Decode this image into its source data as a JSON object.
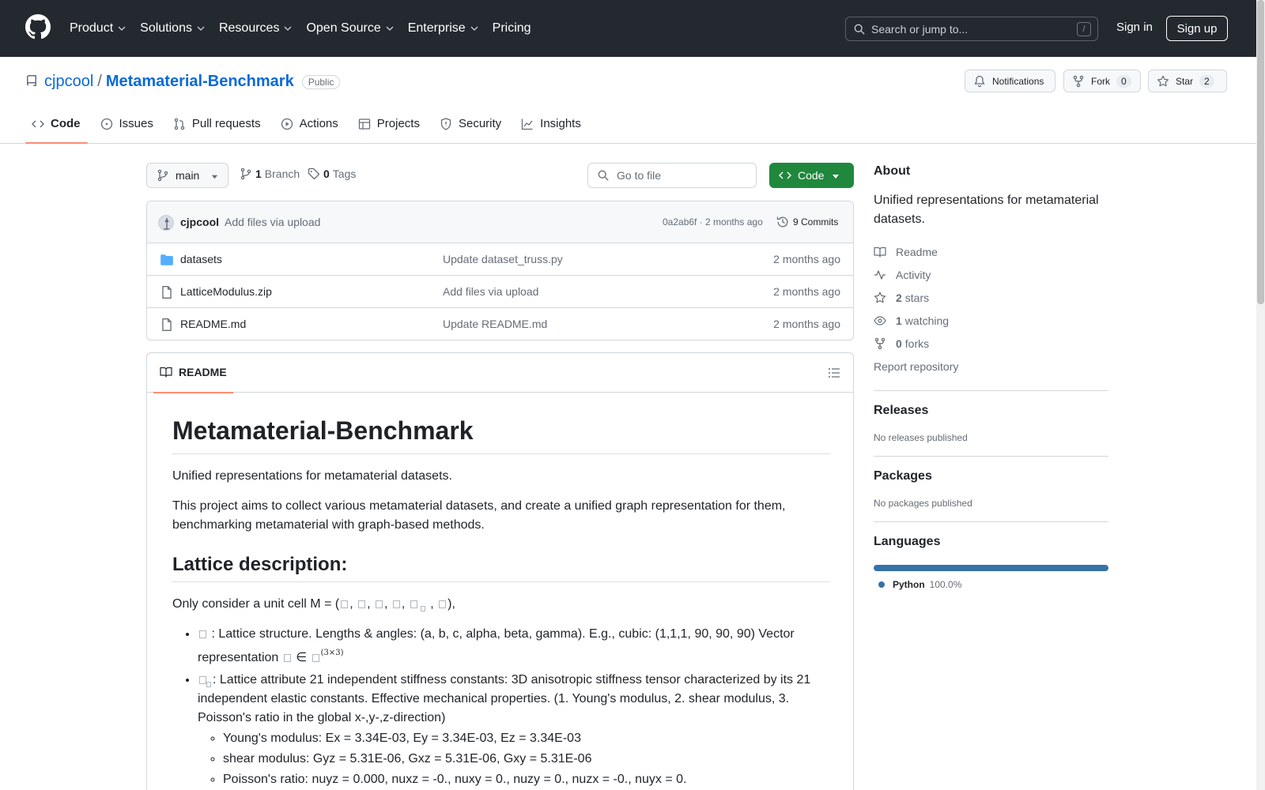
{
  "nav": {
    "items": [
      "Product",
      "Solutions",
      "Resources",
      "Open Source",
      "Enterprise",
      "Pricing"
    ],
    "search_placeholder": "Search or jump to...",
    "search_key": "/",
    "signin": "Sign in",
    "signup": "Sign up"
  },
  "repo": {
    "owner": "cjpcool",
    "separator": "/",
    "name": "Metamaterial-Benchmark",
    "visibility": "Public",
    "notifications": "Notifications",
    "fork_label": "Fork",
    "fork_count": "0",
    "star_label": "Star",
    "star_count": "2"
  },
  "tabs": [
    "Code",
    "Issues",
    "Pull requests",
    "Actions",
    "Projects",
    "Security",
    "Insights"
  ],
  "toolbar": {
    "branch": "main",
    "branch_count": "1",
    "branch_label": "Branch",
    "tag_count": "0",
    "tag_label": "Tags",
    "goto_placeholder": "Go to file",
    "code_label": "Code"
  },
  "commit": {
    "author": "cjpcool",
    "message": "Add files via upload",
    "meta": "0a2ab6f · 2 months ago",
    "commits": "9 Commits"
  },
  "files": [
    {
      "name": "datasets",
      "type": "folder",
      "message": "Update dataset_truss.py",
      "age": "2 months ago"
    },
    {
      "name": "LatticeModulus.zip",
      "type": "file",
      "message": "Add files via upload",
      "age": "2 months ago"
    },
    {
      "name": "README.md",
      "type": "file",
      "message": "Update README.md",
      "age": "2 months ago"
    }
  ],
  "readme": {
    "tab": "README",
    "title": "Metamaterial-Benchmark",
    "p1": "Unified representations for metamaterial datasets.",
    "p2": "This project aims to collect various metamaterial datasets, and create a unified graph representation for them, benchmarking metamaterial with graph-based methods.",
    "h2": "Lattice description:",
    "p3_prefix": "Only consider a unit cell M = (",
    "p3_suffix": "),",
    "li1_text": ": Lattice structure. Lengths & angles: (a, b, c, alpha, beta, gamma). E.g., cubic: (1,1,1, 90, 90, 90) Vector representation",
    "li1_in": "∈",
    "li1_sup": "(3×3)",
    "li2_text": ": Lattice attribute 21 independent stiffness constants: 3D anisotropic stiffness tensor characterized by its 21 independent elastic constants. Effective mechanical properties. (1. Young's modulus, 2. shear modulus, 3. Poisson's ratio in the global x-,y-,z-direction)",
    "sub": [
      "Young's modulus: Ex = 3.34E-03, Ey = 3.34E-03, Ez = 3.34E-03",
      "shear modulus: Gyz = 5.31E-06, Gxz = 5.31E-06, Gxy = 5.31E-06",
      "Poisson's ratio: nuyz = 0.000, nuxz = -0., nuxy = 0., nuzy = 0., nuzx = -0., nuyx = 0."
    ]
  },
  "sidebar": {
    "about_title": "About",
    "about_desc": "Unified representations for metamaterial datasets.",
    "readme": "Readme",
    "activity": "Activity",
    "stars_count": "2",
    "stars_label": "stars",
    "watching_count": "1",
    "watching_label": "watching",
    "forks_count": "0",
    "forks_label": "forks",
    "report": "Report repository",
    "releases_title": "Releases",
    "releases_text": "No releases published",
    "packages_title": "Packages",
    "packages_text": "No packages published",
    "languages_title": "Languages",
    "lang_name": "Python",
    "lang_pct": "100.0%",
    "lang_color": "#3572a5"
  }
}
